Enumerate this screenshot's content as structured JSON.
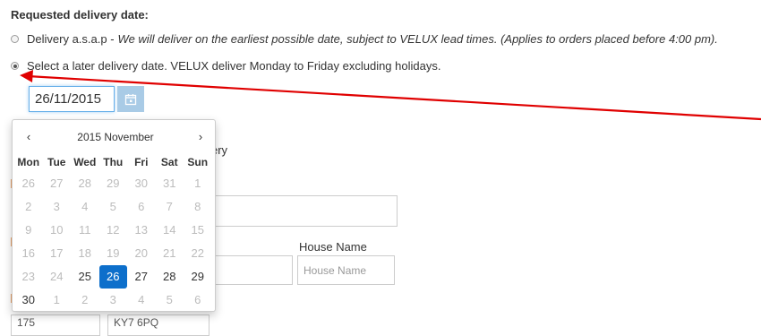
{
  "section_title": "Requested delivery date:",
  "options": [
    {
      "label": "Delivery a.s.a.p - ",
      "note": "We will deliver on the earliest possible date, subject to VELUX lead times. (Applies to orders placed before 4:00 pm).",
      "checked": false
    },
    {
      "label": "Select a later delivery date.  VELUX deliver Monday to Friday excluding holidays.",
      "note": "",
      "checked": true
    }
  ],
  "date_input": {
    "value": "26/11/2015"
  },
  "calendar_button_icon": "calendar-icon",
  "datepicker": {
    "prev_label": "‹",
    "next_label": "›",
    "title": "2015 November",
    "weekdays": [
      "Mon",
      "Tue",
      "Wed",
      "Thu",
      "Fri",
      "Sat",
      "Sun"
    ],
    "weeks": [
      [
        {
          "d": "26",
          "s": "disabled"
        },
        {
          "d": "27",
          "s": "disabled"
        },
        {
          "d": "28",
          "s": "disabled"
        },
        {
          "d": "29",
          "s": "disabled"
        },
        {
          "d": "30",
          "s": "disabled"
        },
        {
          "d": "31",
          "s": "disabled"
        },
        {
          "d": "1",
          "s": "disabled"
        }
      ],
      [
        {
          "d": "2",
          "s": "disabled"
        },
        {
          "d": "3",
          "s": "disabled"
        },
        {
          "d": "4",
          "s": "disabled"
        },
        {
          "d": "5",
          "s": "disabled"
        },
        {
          "d": "6",
          "s": "disabled"
        },
        {
          "d": "7",
          "s": "disabled"
        },
        {
          "d": "8",
          "s": "disabled"
        }
      ],
      [
        {
          "d": "9",
          "s": "disabled"
        },
        {
          "d": "10",
          "s": "disabled"
        },
        {
          "d": "11",
          "s": "disabled"
        },
        {
          "d": "12",
          "s": "disabled"
        },
        {
          "d": "13",
          "s": "disabled"
        },
        {
          "d": "14",
          "s": "disabled"
        },
        {
          "d": "15",
          "s": "disabled"
        }
      ],
      [
        {
          "d": "16",
          "s": "disabled"
        },
        {
          "d": "17",
          "s": "disabled"
        },
        {
          "d": "18",
          "s": "disabled"
        },
        {
          "d": "19",
          "s": "disabled"
        },
        {
          "d": "20",
          "s": "disabled"
        },
        {
          "d": "21",
          "s": "disabled"
        },
        {
          "d": "22",
          "s": "disabled"
        }
      ],
      [
        {
          "d": "23",
          "s": "disabled"
        },
        {
          "d": "24",
          "s": "disabled"
        },
        {
          "d": "25",
          "s": "enabled"
        },
        {
          "d": "26",
          "s": "active"
        },
        {
          "d": "27",
          "s": "enabled"
        },
        {
          "d": "28",
          "s": "enabled"
        },
        {
          "d": "29",
          "s": "enabled"
        }
      ],
      [
        {
          "d": "30",
          "s": "enabled"
        },
        {
          "d": "1",
          "s": "muted"
        },
        {
          "d": "2",
          "s": "muted"
        },
        {
          "d": "3",
          "s": "muted"
        },
        {
          "d": "4",
          "s": "muted"
        },
        {
          "d": "5",
          "s": "muted"
        },
        {
          "d": "6",
          "s": "muted"
        }
      ]
    ]
  },
  "background_form": {
    "partial_text": "ery",
    "house_label": "House Name",
    "house_placeholder": "House Name",
    "partial_cell_1": "175",
    "partial_cell_2": "KY7 6PQ"
  },
  "colors": {
    "accent_blue": "#0d6fcb",
    "calendar_button": "#a9cbe6",
    "annotation_arrow": "#e00000"
  }
}
